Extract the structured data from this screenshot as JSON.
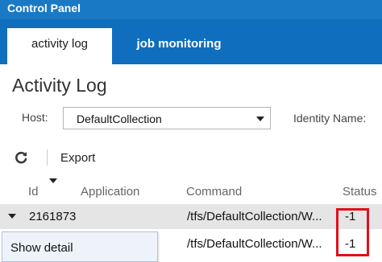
{
  "window": {
    "title": "Control Panel"
  },
  "tabs": [
    {
      "label": "activity log",
      "active": true
    },
    {
      "label": "job monitoring",
      "active": false
    }
  ],
  "page": {
    "title": "Activity Log"
  },
  "filters": {
    "host_label": "Host:",
    "host_value": "DefaultCollection",
    "identity_label": "Identity Name:"
  },
  "toolbar": {
    "refresh_icon": "refresh-icon",
    "export_label": "Export"
  },
  "table": {
    "columns": [
      "Id",
      "Application",
      "Command",
      "Status"
    ],
    "sorted_column": "Id",
    "rows": [
      {
        "id": "2161873",
        "application": "",
        "command": "/tfs/DefaultCollection/W...",
        "status": "-1",
        "selected": true
      },
      {
        "id": "",
        "application": "",
        "command": "/tfs/DefaultCollection/W...",
        "status": "-1",
        "selected": false
      }
    ]
  },
  "context_menu": {
    "items": [
      "Show detail"
    ]
  },
  "colors": {
    "title_bar": "#1a79c4",
    "tab_strip": "#0f6fbe",
    "highlight": "#e0101b",
    "selected_row": "#e5e5e5"
  }
}
